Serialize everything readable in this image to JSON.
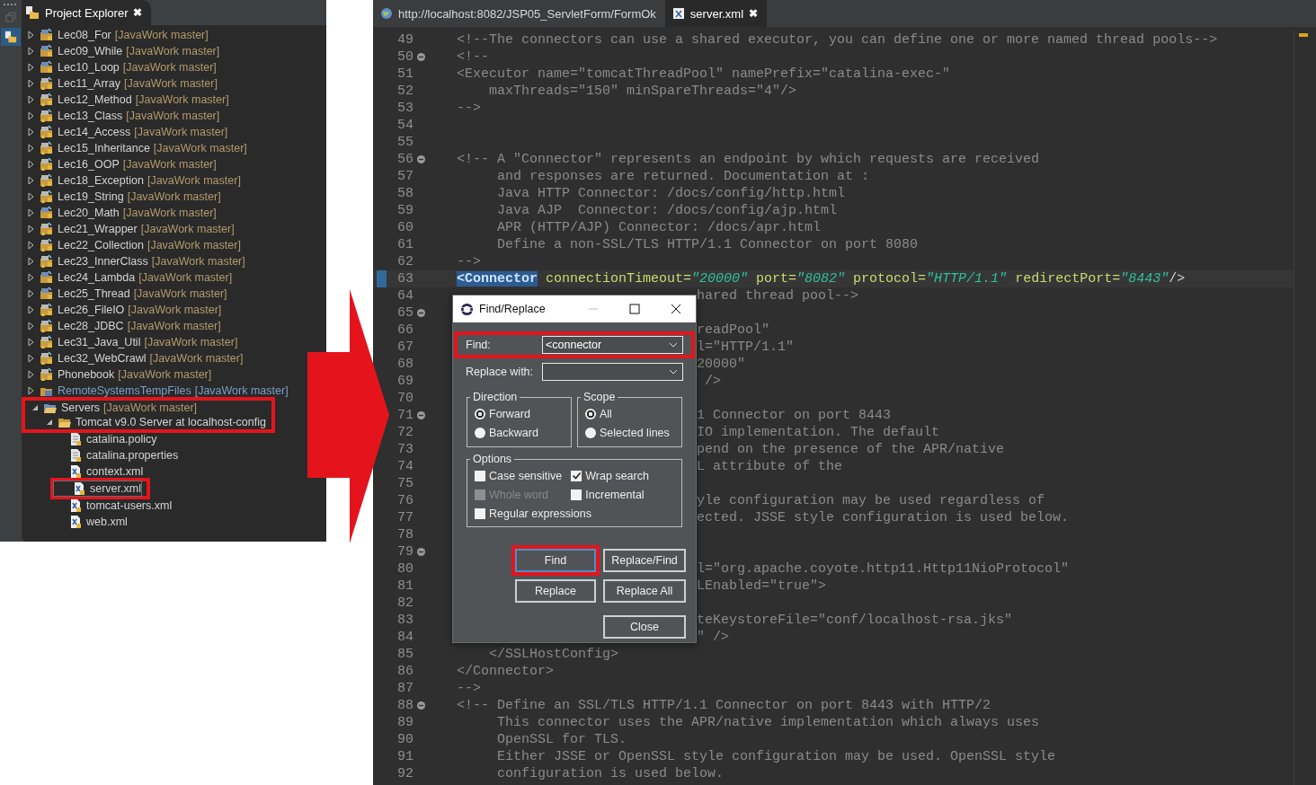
{
  "explorer": {
    "tab": {
      "title": "Project Explorer",
      "close": "✖"
    },
    "items": [
      {
        "name": "Lec08_For",
        "repo": "[JavaWork master]",
        "kind": "project",
        "expanded": false,
        "selected": false,
        "highlighted": false
      },
      {
        "name": "Lec09_While",
        "repo": "[JavaWork master]",
        "kind": "project",
        "expanded": false,
        "selected": false,
        "highlighted": false
      },
      {
        "name": "Lec10_Loop",
        "repo": "[JavaWork master]",
        "kind": "project",
        "expanded": false,
        "selected": false,
        "highlighted": false
      },
      {
        "name": "Lec11_Array",
        "repo": "[JavaWork master]",
        "kind": "project-warning",
        "expanded": false,
        "selected": false,
        "highlighted": false
      },
      {
        "name": "Lec12_Method",
        "repo": "[JavaWork master]",
        "kind": "project-warning",
        "expanded": false,
        "selected": false,
        "highlighted": false
      },
      {
        "name": "Lec13_Class",
        "repo": "[JavaWork master]",
        "kind": "project-warning",
        "expanded": false,
        "selected": false,
        "highlighted": false
      },
      {
        "name": "Lec14_Access",
        "repo": "[JavaWork master]",
        "kind": "project-warning",
        "expanded": false,
        "selected": false,
        "highlighted": false
      },
      {
        "name": "Lec15_Inheritance",
        "repo": "[JavaWork master]",
        "kind": "project-warning",
        "expanded": false,
        "selected": false,
        "highlighted": false
      },
      {
        "name": "Lec16_OOP",
        "repo": "[JavaWork master]",
        "kind": "project-warning",
        "expanded": false,
        "selected": false,
        "highlighted": false
      },
      {
        "name": "Lec18_Exception",
        "repo": "[JavaWork master]",
        "kind": "project-warning",
        "expanded": false,
        "selected": false,
        "highlighted": false
      },
      {
        "name": "Lec19_String",
        "repo": "[JavaWork master]",
        "kind": "project-warning",
        "expanded": false,
        "selected": false,
        "highlighted": false
      },
      {
        "name": "Lec20_Math",
        "repo": "[JavaWork master]",
        "kind": "project",
        "expanded": false,
        "selected": false,
        "highlighted": false
      },
      {
        "name": "Lec21_Wrapper",
        "repo": "[JavaWork master]",
        "kind": "project-warning",
        "expanded": false,
        "selected": false,
        "highlighted": false
      },
      {
        "name": "Lec22_Collection",
        "repo": "[JavaWork master]",
        "kind": "project-warning",
        "expanded": false,
        "selected": false,
        "highlighted": false
      },
      {
        "name": "Lec23_InnerClass",
        "repo": "[JavaWork master]",
        "kind": "project-warning",
        "expanded": false,
        "selected": false,
        "highlighted": false
      },
      {
        "name": "Lec24_Lambda",
        "repo": "[JavaWork master]",
        "kind": "project",
        "expanded": false,
        "selected": false,
        "highlighted": false
      },
      {
        "name": "Lec25_Thread",
        "repo": "[JavaWork master]",
        "kind": "project",
        "expanded": false,
        "selected": false,
        "highlighted": false
      },
      {
        "name": "Lec26_FileIO",
        "repo": "[JavaWork master]",
        "kind": "project-warning",
        "expanded": false,
        "selected": false,
        "highlighted": false
      },
      {
        "name": "Lec28_JDBC",
        "repo": "[JavaWork master]",
        "kind": "project-warning",
        "expanded": false,
        "selected": false,
        "highlighted": false
      },
      {
        "name": "Lec31_Java_Util",
        "repo": "[JavaWork master]",
        "kind": "project-warning",
        "expanded": false,
        "selected": false,
        "highlighted": false
      },
      {
        "name": "Lec32_WebCrawl",
        "repo": "[JavaWork master]",
        "kind": "project-warning",
        "expanded": false,
        "selected": false,
        "highlighted": false
      },
      {
        "name": "Phonebook",
        "repo": "[JavaWork master]",
        "kind": "project-warning",
        "expanded": false,
        "selected": false,
        "highlighted": false
      },
      {
        "name": "RemoteSystemsTempFiles",
        "repo": "[JavaWork master]",
        "kind": "remote",
        "expanded": false,
        "selected": false,
        "highlighted": false
      },
      {
        "name": "Servers",
        "repo": "[JavaWork master]",
        "kind": "servers",
        "expanded": true,
        "selected": false,
        "highlighted": true,
        "children": [
          {
            "name": "Tomcat v9.0 Server at localhost-config",
            "kind": "folder",
            "expanded": true,
            "selected": false,
            "highlighted": true,
            "children": [
              {
                "name": "catalina.policy",
                "kind": "text-file",
                "selected": false,
                "highlighted": false
              },
              {
                "name": "catalina.properties",
                "kind": "text-file",
                "selected": false,
                "highlighted": false
              },
              {
                "name": "context.xml",
                "kind": "xml-file",
                "selected": false,
                "highlighted": false
              },
              {
                "name": "server.xml",
                "kind": "xml-file",
                "selected": true,
                "highlighted": true
              },
              {
                "name": "tomcat-users.xml",
                "kind": "xml-file",
                "selected": false,
                "highlighted": false
              },
              {
                "name": "web.xml",
                "kind": "xml-file",
                "selected": false,
                "highlighted": false
              }
            ]
          }
        ]
      }
    ]
  },
  "editor": {
    "tabs": [
      {
        "title": "http://localhost:8082/JSP05_ServletForm/FormOk",
        "kind": "web",
        "selected": false
      },
      {
        "title": "server.xml",
        "kind": "xml",
        "selected": true,
        "close": "✖"
      }
    ],
    "lines": [
      {
        "number": "49",
        "fold": false,
        "covered": false,
        "current": false,
        "text": "<!--The connectors can use a shared executor, you can define one or more named thread pools-->"
      },
      {
        "number": "50",
        "fold": true,
        "covered": false,
        "current": false,
        "text": "<!--"
      },
      {
        "number": "51",
        "fold": false,
        "covered": false,
        "current": false,
        "text": "<Executor name=\"tomcatThreadPool\" namePrefix=\"catalina-exec-\""
      },
      {
        "number": "52",
        "fold": false,
        "covered": false,
        "current": false,
        "text": "    maxThreads=\"150\" minSpareThreads=\"4\"/>"
      },
      {
        "number": "53",
        "fold": false,
        "covered": false,
        "current": false,
        "text": "-->"
      },
      {
        "number": "54",
        "fold": false,
        "current": false
      },
      {
        "number": "55",
        "fold": false,
        "current": false
      },
      {
        "number": "56",
        "fold": true,
        "covered": false,
        "current": false,
        "text": "<!-- A \"Connector\" represents an endpoint by which requests are received"
      },
      {
        "number": "57",
        "fold": false,
        "covered": false,
        "current": false,
        "text": "     and responses are returned. Documentation at :"
      },
      {
        "number": "58",
        "fold": false,
        "covered": false,
        "current": false,
        "text": "     Java HTTP Connector: /docs/config/http.html"
      },
      {
        "number": "59",
        "fold": false,
        "covered": false,
        "current": false,
        "text": "     Java AJP  Connector: /docs/config/ajp.html"
      },
      {
        "number": "60",
        "fold": false,
        "covered": false,
        "current": false,
        "text": "     APR (HTTP/AJP) Connector: /docs/apr.html"
      },
      {
        "number": "61",
        "fold": false,
        "covered": false,
        "current": false,
        "text": "     Define a non-SSL/TLS HTTP/1.1 Connector on port 8080"
      },
      {
        "number": "62",
        "fold": false,
        "covered": false,
        "current": false,
        "text": "-->"
      },
      {
        "number": "63",
        "fold": false,
        "current": true,
        "tokens": [
          {
            "text": "<Connector",
            "kind": "tag",
            "selected": true
          },
          {
            "text": " connectionTimeout=",
            "kind": "attr",
            "selected": false
          },
          {
            "text": "\"20000\"",
            "kind": "value",
            "selected": false
          },
          {
            "text": " port=",
            "kind": "attr",
            "selected": false
          },
          {
            "text": "\"8082\"",
            "kind": "value",
            "selected": false
          },
          {
            "text": " protocol=",
            "kind": "attr",
            "selected": false
          },
          {
            "text": "\"HTTP/1.1\"",
            "kind": "value",
            "selected": false
          },
          {
            "text": " redirectPort=",
            "kind": "attr",
            "selected": false
          },
          {
            "text": "\"8443\"",
            "kind": "value",
            "selected": false
          },
          {
            "text": "/>",
            "kind": "punct",
            "selected": false
          }
        ]
      },
      {
        "number": "64",
        "fold": false,
        "covered": true,
        "current": false,
        "text": "hared thread pool-->"
      },
      {
        "number": "65",
        "fold": true,
        "current": false
      },
      {
        "number": "66",
        "fold": false,
        "covered": true,
        "current": false,
        "text": "readPool\""
      },
      {
        "number": "67",
        "fold": false,
        "covered": true,
        "current": false,
        "text": "l=\"HTTP/1.1\""
      },
      {
        "number": "68",
        "fold": false,
        "covered": true,
        "current": false,
        "text": "20000\""
      },
      {
        "number": "69",
        "fold": false,
        "covered": true,
        "current": false,
        "text": " />"
      },
      {
        "number": "70",
        "fold": false,
        "current": false
      },
      {
        "number": "71",
        "fold": true,
        "covered": true,
        "current": false,
        "text": "1 Connector on port 8443"
      },
      {
        "number": "72",
        "fold": false,
        "covered": true,
        "current": false,
        "text": "IO implementation. The default"
      },
      {
        "number": "73",
        "fold": false,
        "covered": true,
        "current": false,
        "text": "pend on the presence of the APR/native"
      },
      {
        "number": "74",
        "fold": false,
        "covered": true,
        "current": false,
        "text": "L attribute of the"
      },
      {
        "number": "75",
        "fold": false,
        "current": false
      },
      {
        "number": "76",
        "fold": false,
        "covered": true,
        "current": false,
        "text": "yle configuration may be used regardless of"
      },
      {
        "number": "77",
        "fold": false,
        "covered": true,
        "current": false,
        "text": "ected. JSSE style configuration is used below."
      },
      {
        "number": "78",
        "fold": false,
        "current": false
      },
      {
        "number": "79",
        "fold": true,
        "current": false
      },
      {
        "number": "80",
        "fold": false,
        "covered": true,
        "current": false,
        "text": "l=\"org.apache.coyote.http11.Http11NioProtocol\""
      },
      {
        "number": "81",
        "fold": false,
        "covered": true,
        "current": false,
        "text": "LEnabled=\"true\">"
      },
      {
        "number": "82",
        "fold": false,
        "current": false
      },
      {
        "number": "83",
        "fold": false,
        "covered": true,
        "current": false,
        "text": "teKeystoreFile=\"conf/localhost-rsa.jks\""
      },
      {
        "number": "84",
        "fold": false,
        "covered": true,
        "current": false,
        "text": "\" />"
      },
      {
        "number": "85",
        "fold": false,
        "covered": false,
        "current": false,
        "text": "    </SSLHostConfig>"
      },
      {
        "number": "86",
        "fold": false,
        "covered": false,
        "current": false,
        "text": "</Connector>"
      },
      {
        "number": "87",
        "fold": false,
        "covered": false,
        "current": false,
        "text": "-->"
      },
      {
        "number": "88",
        "fold": true,
        "covered": false,
        "current": false,
        "text": "<!-- Define an SSL/TLS HTTP/1.1 Connector on port 8443 with HTTP/2"
      },
      {
        "number": "89",
        "fold": false,
        "covered": false,
        "current": false,
        "text": "     This connector uses the APR/native implementation which always uses"
      },
      {
        "number": "90",
        "fold": false,
        "covered": false,
        "current": false,
        "text": "     OpenSSL for TLS."
      },
      {
        "number": "91",
        "fold": false,
        "covered": false,
        "current": false,
        "text": "     Either JSSE or OpenSSL style configuration may be used. OpenSSL style"
      },
      {
        "number": "92",
        "fold": false,
        "covered": false,
        "current": false,
        "text": "     configuration is used below."
      }
    ]
  },
  "dialog": {
    "title": "Find/Replace",
    "fields": [
      {
        "label": "Find:",
        "value": "<connector",
        "highlighted": true
      },
      {
        "label": "Replace with:",
        "highlighted": false
      }
    ],
    "groups": [
      {
        "title": "Direction",
        "options": [
          {
            "label": "Forward",
            "selected": true
          },
          {
            "label": "Backward",
            "selected": false
          }
        ]
      },
      {
        "title": "Scope",
        "options": [
          {
            "label": "All",
            "selected": true
          },
          {
            "label": "Selected lines",
            "selected": false
          }
        ]
      }
    ],
    "options": {
      "title": "Options",
      "items": [
        {
          "label": "Case sensitive",
          "checked": false,
          "disabled": false
        },
        {
          "label": "Wrap search",
          "checked": true,
          "disabled": false
        },
        {
          "label": "Whole word",
          "checked": false,
          "disabled": true
        },
        {
          "label": "Incremental",
          "checked": false,
          "disabled": false
        },
        {
          "label": "Regular expressions",
          "checked": false,
          "disabled": false
        }
      ]
    },
    "buttons": [
      {
        "label": "Find",
        "focused": true,
        "highlighted": true
      },
      {
        "label": "Replace/Find",
        "focused": false,
        "highlighted": false
      },
      {
        "label": "Replace",
        "focused": false,
        "highlighted": false
      },
      {
        "label": "Replace All",
        "focused": false,
        "highlighted": false
      },
      {
        "label": "Close",
        "focused": false,
        "highlighted": false
      }
    ]
  }
}
